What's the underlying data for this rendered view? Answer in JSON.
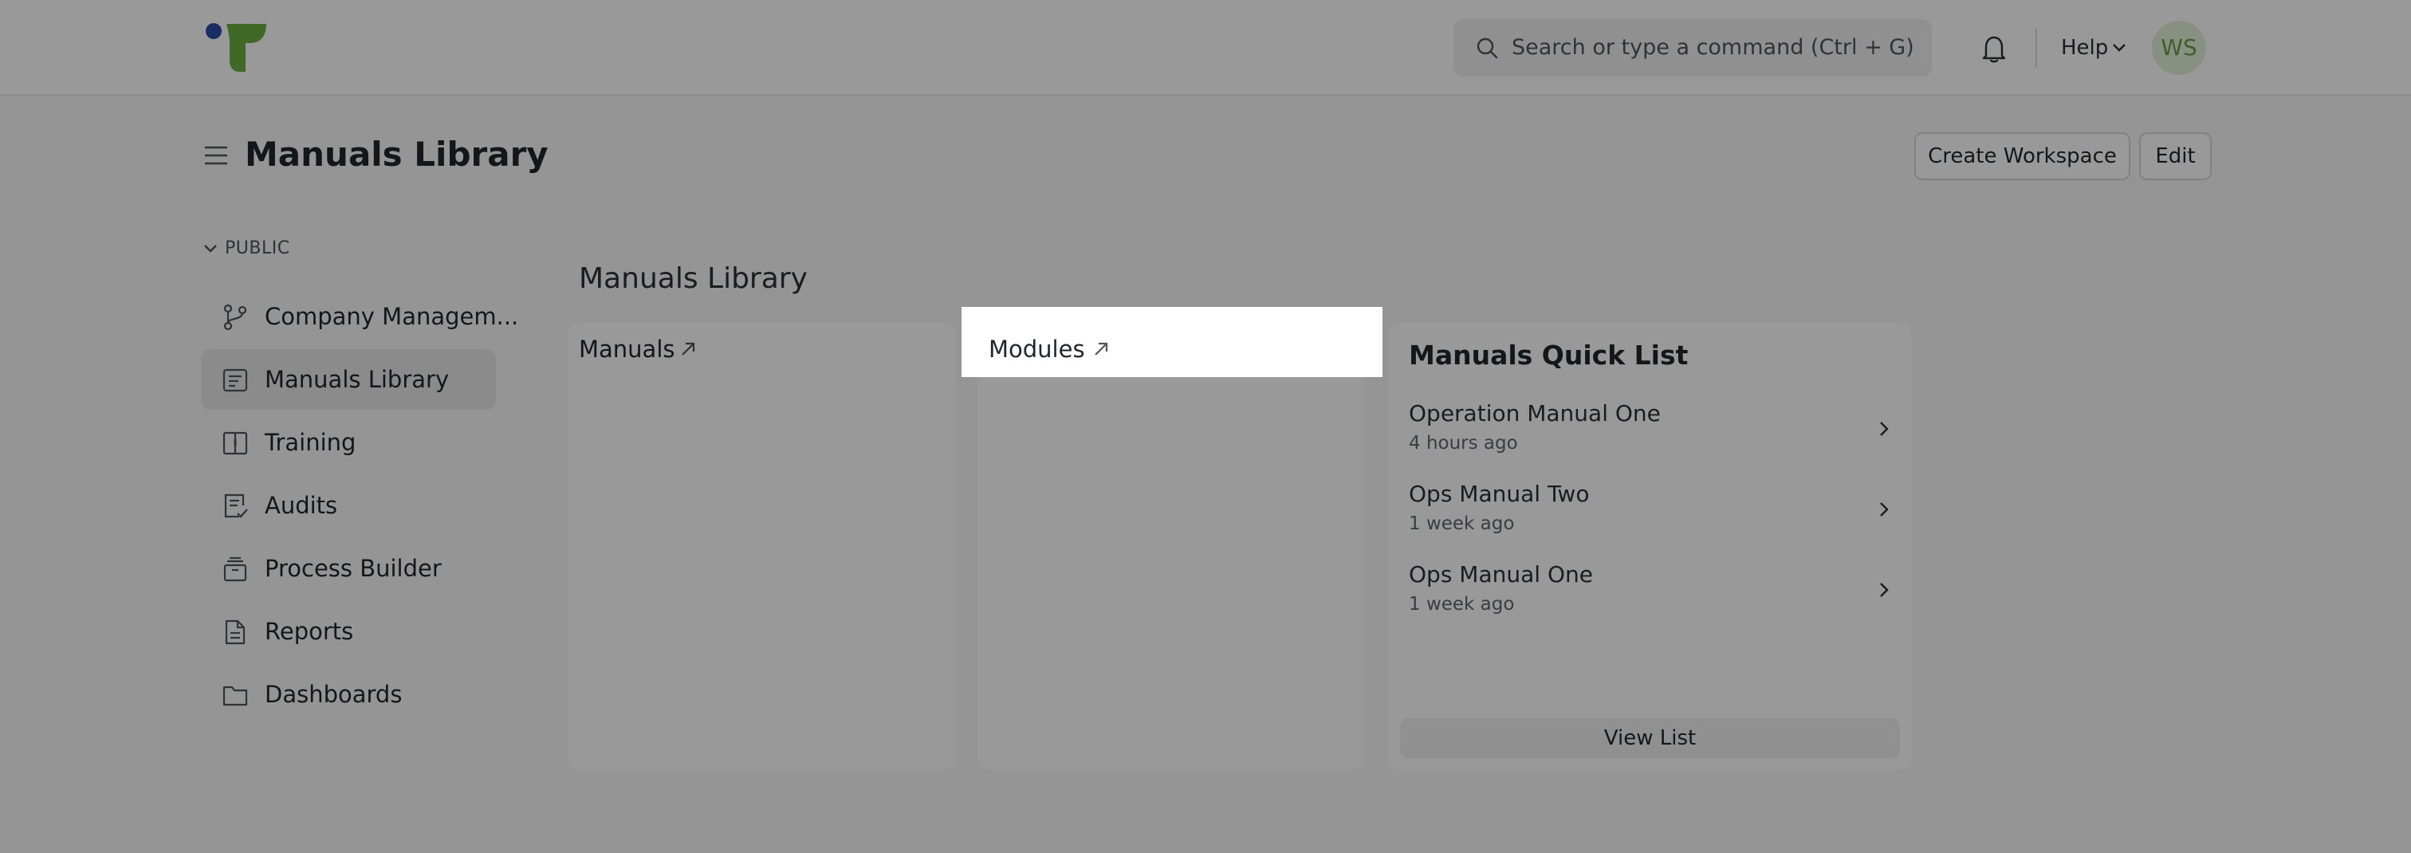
{
  "navbar": {
    "search_placeholder": "Search or type a command (Ctrl + G)",
    "help_label": "Help",
    "avatar_initials": "WS"
  },
  "header": {
    "title": "Manuals Library",
    "create_workspace_label": "Create Workspace",
    "edit_label": "Edit"
  },
  "sidebar": {
    "section_label": "PUBLIC",
    "items": [
      {
        "label": "Company Managem...",
        "icon": "git-branch-icon"
      },
      {
        "label": "Manuals Library",
        "icon": "book-list-icon",
        "active": true
      },
      {
        "label": "Training",
        "icon": "open-book-icon"
      },
      {
        "label": "Audits",
        "icon": "checklist-icon"
      },
      {
        "label": "Process Builder",
        "icon": "stack-icon"
      },
      {
        "label": "Reports",
        "icon": "document-icon"
      },
      {
        "label": "Dashboards",
        "icon": "folder-icon"
      }
    ]
  },
  "main": {
    "section_title": "Manuals Library",
    "cards": {
      "manuals_label": "Manuals",
      "modules_label": "Modules"
    },
    "quick_list": {
      "title": "Manuals Quick List",
      "items": [
        {
          "name": "Operation Manual One",
          "time": "4 hours ago"
        },
        {
          "name": "Ops Manual Two",
          "time": "1 week ago"
        },
        {
          "name": "Ops Manual One",
          "time": "1 week ago"
        }
      ],
      "view_list_label": "View List"
    }
  },
  "colors": {
    "logo_blue": "#2a4ea8",
    "logo_green": "#6aaf3d",
    "avatar_bg": "#e3f1d9",
    "avatar_text": "#6b9d45"
  }
}
